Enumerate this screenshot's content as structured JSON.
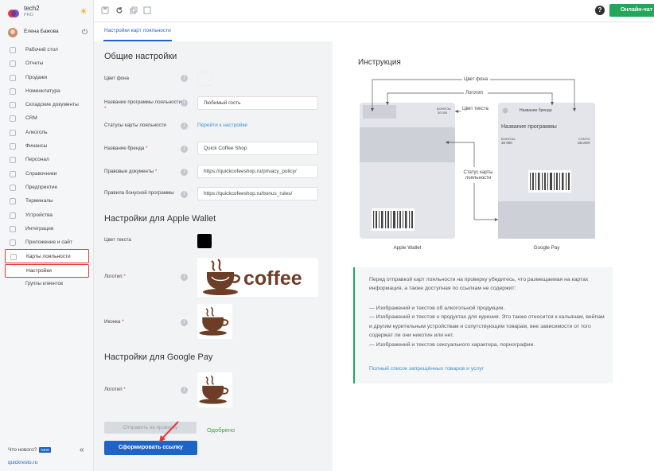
{
  "brand": {
    "name": "tech2",
    "plan": "PRO"
  },
  "user": {
    "name": "Елена Бажова"
  },
  "sidebar": {
    "items": [
      {
        "label": "Рабочий стол",
        "icon": "dashboard-icon"
      },
      {
        "label": "Отчеты",
        "icon": "chart-icon"
      },
      {
        "label": "Продажи",
        "icon": "cart-icon"
      },
      {
        "label": "Номенклатура",
        "icon": "tag-icon"
      },
      {
        "label": "Складские документы",
        "icon": "box-icon"
      },
      {
        "label": "CRM",
        "icon": "star-icon"
      },
      {
        "label": "Алкоголь",
        "icon": "glass-icon"
      },
      {
        "label": "Финансы",
        "icon": "wallet-icon"
      },
      {
        "label": "Персонал",
        "icon": "user-icon"
      },
      {
        "label": "Справочники",
        "icon": "book-icon"
      },
      {
        "label": "Предприятие",
        "icon": "building-icon"
      },
      {
        "label": "Терминалы",
        "icon": "terminal-icon"
      },
      {
        "label": "Устройства",
        "icon": "device-icon"
      },
      {
        "label": "Интеграции",
        "icon": "plug-icon"
      },
      {
        "label": "Приложение и сайт",
        "icon": "globe-icon"
      },
      {
        "label": "Карты лояльности",
        "icon": "card-icon"
      }
    ],
    "sub_active": "Настройки",
    "sub_other": "Группы клиентов",
    "whats_new": "Что нового?",
    "new_badge": "NEW",
    "collapse_glyph": "«",
    "site": "quickresto.ru"
  },
  "topbar": {
    "help": "?",
    "chat": "Онлайн-чат"
  },
  "tabs": {
    "active": "Настройки карт лояльности"
  },
  "form": {
    "general_title": "Общие настройки",
    "bg_color_label": "Цвет фона",
    "bg_color": "#f2f3f5",
    "program_name_label": "Название программы лояльности",
    "program_name_value": "Любимый гость",
    "status_label": "Статусы карты лояльности",
    "status_link": "Перейти к настройке",
    "brand_label": "Название бренда",
    "brand_value": "Quick Coffee Shop",
    "legal_label": "Правовые документы",
    "legal_value": "https://quickcofeeshop.ru/privacy_policy/",
    "rules_label": "Правила бонусной программы",
    "rules_value": "https://quickcofeeshop.ru/bonus_rules/",
    "apple_title": "Настройки для Apple Wallet",
    "text_color_label": "Цвет текста",
    "text_color": "#000000",
    "logo_label": "Логотип",
    "logo_word": "coffee",
    "icon_label": "Иконка",
    "google_title": "Настройки для Google Pay",
    "glogo_label": "Логотип",
    "required_mark": "*",
    "info_glyph": "i",
    "send_button": "Отправить на проверку",
    "approved": "Одобрено",
    "generate_button": "Сформировать ссылку"
  },
  "instruction": {
    "title": "Инструкция",
    "label_bg": "Цвет фона",
    "label_logo": "Логотип",
    "label_text": "Цвет текста",
    "label_status": "Статус карты лояльности",
    "apple_caption": "Apple Wallet",
    "google_caption": "Google Pay",
    "g_brand": "Название бренда",
    "g_program": "Название программы",
    "g_bonus_label": "БОНУСЫ",
    "g_bonus_value": "30 000",
    "g_status_label": "СТАТУС",
    "g_status_value": "SILVER",
    "a_bonus_label": "БОНУСЫ",
    "a_bonus_value": "30 000"
  },
  "note": {
    "intro": "Перед отправкой карт лояльности на проверку убедитесь, что размещаемая на картах информация, а также доступная по ссылкам не содержит:",
    "items": [
      "— Изображений и текстов об алкогольной продукции.",
      "— Изображений и текстов о продуктах для курения. Это также относится к кальянам, вейпам и другим курительным устройствам и сопутствующим товарам, вне зависимости от того содержат ли они никотин или нет.",
      "— Изображений и текстов сексуального характера, порнографии."
    ],
    "link": "Полный список запрещённых товаров и услуг"
  },
  "colors": {
    "accent": "#1e63c6",
    "chat": "#23a55a",
    "highlight": "#e53935"
  }
}
